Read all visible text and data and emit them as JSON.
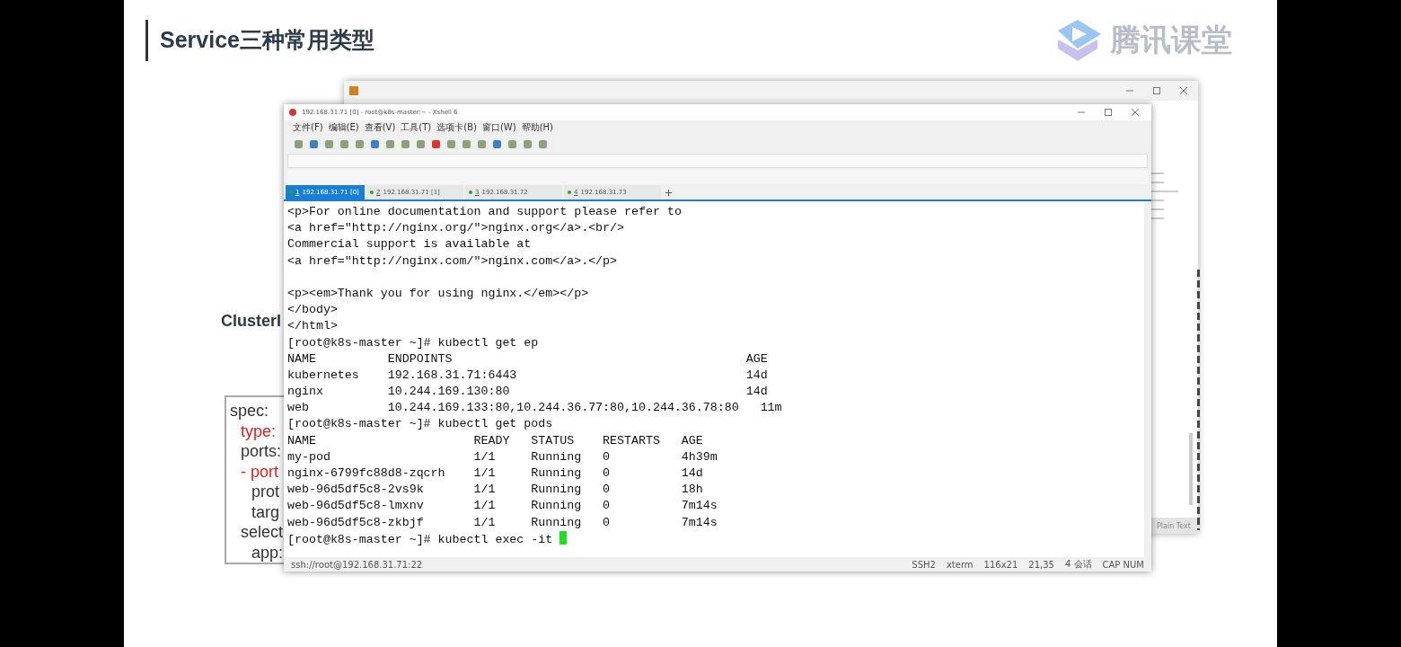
{
  "slide": {
    "title": "Service三种常用类型",
    "logo_text": "腾讯课堂",
    "section_label": "ClusterI",
    "code_lines": [
      {
        "text": "spec:",
        "red": false,
        "children": [
          {
            "text": "type:",
            "red": true
          },
          {
            "text": "ports:",
            "red": false
          },
          {
            "text": "- port",
            "red": true,
            "children": [
              {
                "text": "prot",
                "red": false
              },
              {
                "text": "targ",
                "red": false
              }
            ]
          },
          {
            "text": "select",
            "red": false,
            "children": [
              {
                "text": "app:",
                "red": false
              }
            ]
          }
        ]
      }
    ]
  },
  "back_window": {
    "status": "Plain Text"
  },
  "terminal_window": {
    "title": "192.168.31.71 [0] - root@k8s-master:~ - Xshell 6",
    "menu": [
      "文件(F)",
      "编辑(E)",
      "查看(V)",
      "工具(T)",
      "选项卡(B)",
      "窗口(W)",
      "帮助(H)"
    ],
    "tabs": [
      {
        "num": "1",
        "label": "192.168.31.71 [0]",
        "selected": true
      },
      {
        "num": "2",
        "label": "192.168.31.71 [1]",
        "selected": false
      },
      {
        "num": "3",
        "label": "192.168.31.72",
        "selected": false
      },
      {
        "num": "4",
        "label": "192.168.31.73",
        "selected": false
      }
    ],
    "blocks": [
      [
        "<p>For online documentation and support please refer to",
        "<a href=\"http://nginx.org/\">nginx.org</a>.<br/>",
        "Commercial support is available at",
        "<a href=\"http://nginx.com/\">nginx.com</a>.</p>"
      ],
      [
        "<p><em>Thank you for using nginx.</em></p>",
        "</body>",
        "</html>",
        "[root@k8s-master ~]# kubectl get ep",
        "NAME          ENDPOINTS                                         AGE",
        "kubernetes    192.168.31.71:6443                                14d",
        "nginx         10.244.169.130:80                                 14d",
        "web           10.244.169.133:80,10.244.36.77:80,10.244.36.78:80   11m",
        "[root@k8s-master ~]# kubectl get pods",
        "NAME                      READY   STATUS    RESTARTS   AGE",
        "my-pod                    1/1     Running   0          4h39m",
        "nginx-6799fc88d8-zqcrh    1/1     Running   0          14d",
        "web-96d5df5c8-2vs9k       1/1     Running   0          18h",
        "web-96d5df5c8-lmxnv       1/1     Running   0          7m14s",
        "web-96d5df5c8-zkbjf       1/1     Running   0          7m14s",
        "[root@k8s-master ~]# kubectl exec -it "
      ]
    ],
    "cursor_visible": true,
    "status": [
      "ssh://root@192.168.31.71:22",
      "SSH2",
      "xterm",
      "116x21",
      "21,35",
      "4 会话",
      "CAP NUM"
    ]
  }
}
